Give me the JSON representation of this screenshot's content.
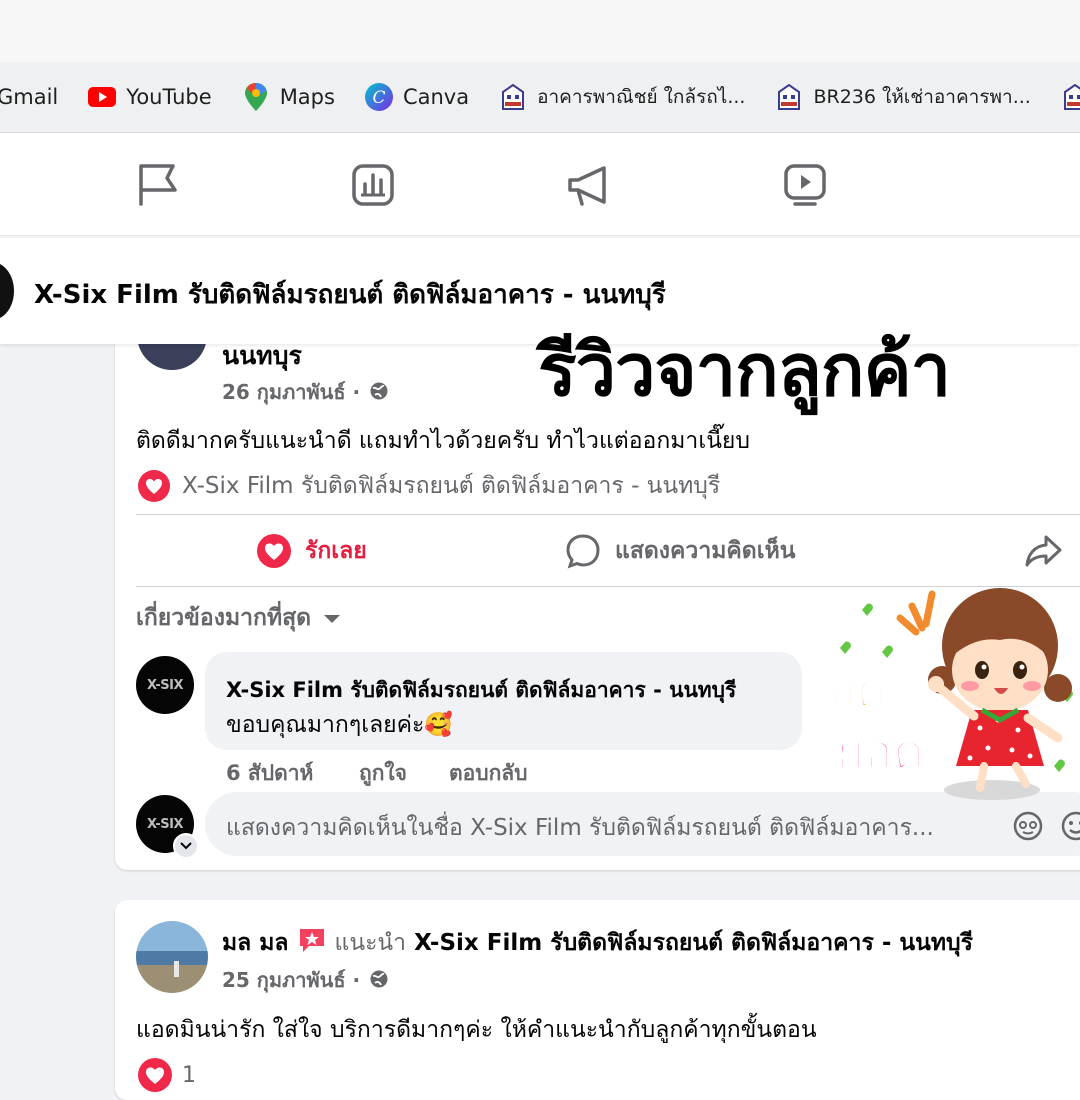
{
  "bookmarks": [
    {
      "label": "Gmail",
      "icon": "gmail-icon"
    },
    {
      "label": "YouTube",
      "icon": "youtube-icon"
    },
    {
      "label": "Maps",
      "icon": "maps-icon"
    },
    {
      "label": "Canva",
      "icon": "canva-icon"
    },
    {
      "label": "อาคารพาณิชย์ ใกล้รถไ...",
      "icon": "building-icon"
    },
    {
      "label": "BR236 ให้เช่าอาคารพา...",
      "icon": "building-icon"
    }
  ],
  "page_title": "X-Six Film รับติดฟิล์มรถยนต์ ติดฟิล์มอาคาร - นนทบุรี",
  "overlay_title": "รีวิวจากลูกค้า",
  "post1": {
    "author_partial": "นนทบุร",
    "date": "26 กุมภาพันธ์ ·",
    "text": "ติดดีมากครับแนะนำดี แถมทำไวด้วยครับ ทำไวแต่ออกมาเนี๊ยบ",
    "recommends": "X-Six Film รับติดฟิล์มรถยนต์ ติดฟิล์มอาคาร - นนทบุรี",
    "actions": {
      "love": "รักเลย",
      "comment": "แสดงความคิดเห็น"
    },
    "sort_label": "เกี่ยวข้องมากที่สุด",
    "comment": {
      "author": "X-Six Film รับติดฟิล์มรถยนต์ ติดฟิล์มอาคาร - นนทบุรี",
      "text": "ขอบคุณมากๆเลยค่ะ🥰",
      "time": "6 สัปดาห์",
      "like": "ถูกใจ",
      "reply": "ตอบกลับ"
    },
    "comment_placeholder": "แสดงความคิดเห็นในชื่อ X-Six Film รับติดฟิล์มรถยนต์ ติดฟิล์มอาคาร...",
    "avatar_text": "X-SIX"
  },
  "sticker": {
    "text": "สุดยอด"
  },
  "post2": {
    "author": "มล มล",
    "recommends_word": "แนะนำ",
    "page": "X-Six Film รับติดฟิล์มรถยนต์ ติดฟิล์มอาคาร - นนทบุรี",
    "date": "25 กุมภาพันธ์ ·",
    "text": "แอดมินน่ารัก ใส่ใจ บริการดีมากๆค่ะ ให้คำแนะนำกับลูกค้าทุกขั้นตอน",
    "reaction_count": "1"
  },
  "colors": {
    "accent_red": "#e41e3f",
    "muted": "#65676b",
    "bg": "#f0f2f5"
  }
}
